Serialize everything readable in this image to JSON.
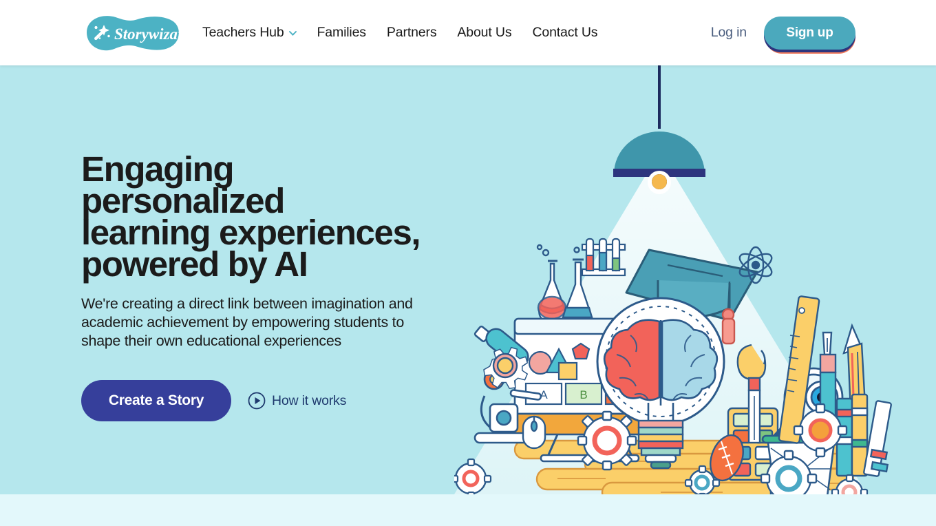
{
  "brand": {
    "name": "Storywizard.ai",
    "logo_icon": "magic-wand-icon",
    "blob_color": "#4cb2c4"
  },
  "header": {
    "nav": [
      {
        "label": "Teachers Hub",
        "has_dropdown": true,
        "dropdown_icon": "chevron-down-icon"
      },
      {
        "label": "Families",
        "has_dropdown": false
      },
      {
        "label": "Partners",
        "has_dropdown": false
      },
      {
        "label": "About Us",
        "has_dropdown": false
      },
      {
        "label": "Contact Us",
        "has_dropdown": false
      }
    ],
    "login_label": "Log in",
    "signup_label": "Sign up",
    "signup_color": "#4ba9bd",
    "signup_shadow_navy": "#2d357e",
    "signup_shadow_orange": "#f07a5d",
    "background": "#ffffff"
  },
  "hero": {
    "background": "#b5e7ed",
    "headline": "Engaging personalized\nlearning experiences,\npowered by AI",
    "subheadline": "We're creating a direct link between imagination and\nacademic achievement by empowering students to\nshape their own educational experiences",
    "primary_cta": {
      "label": "Create a Story",
      "color": "#363f9b"
    },
    "secondary_cta": {
      "label": "How it works",
      "icon": "play-circle-icon",
      "color": "#1f3a6e"
    },
    "illustration": {
      "name": "education-lightbulb-brain-illustration",
      "elements": [
        "hanging-lamp-icon",
        "light-cone",
        "lightbulb-brain-icon",
        "graduation-cap-icon",
        "test-tube-rack-icon",
        "flask-icon",
        "microscope-icon",
        "computer-monitor-icon",
        "computer-mouse-icon",
        "magnifying-glass-eye-icon",
        "calculator-icon",
        "ruler-icon",
        "pen-icon",
        "pencil-icon",
        "paintbrush-icon",
        "pencil-cup-icon",
        "books-icon",
        "atom-icon",
        "football-icon",
        "gear-icon",
        "desk-icon"
      ],
      "palette": {
        "teal": "#4a9fb5",
        "navy": "#1c2b5e",
        "coral": "#f2635a",
        "yellow": "#f9cf6b",
        "light_blue": "#a8d8e8",
        "white": "#ffffff",
        "cone": "#dbf5f8"
      }
    }
  },
  "below_fold": {
    "background": "#e3f8fb"
  }
}
